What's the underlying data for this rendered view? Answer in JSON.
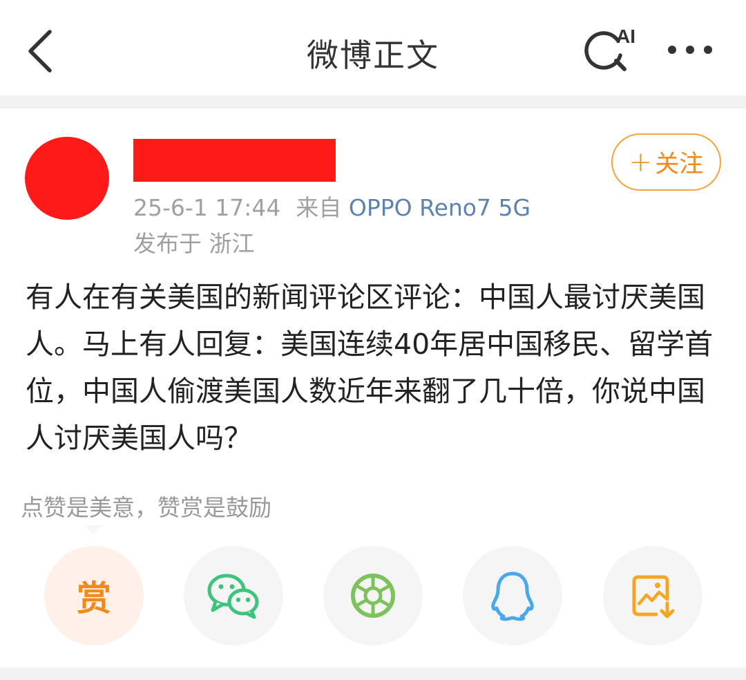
{
  "header": {
    "title": "微博正文",
    "ai_label": "AI",
    "back_icon": "chevron-left-icon",
    "search_icon": "ai-search-icon",
    "more_icon": "more-dots-icon"
  },
  "post": {
    "follow_label": "关注",
    "follow_plus": "+",
    "timestamp": "25-6-1 17:44",
    "source_prefix": "来自",
    "device": "OPPO Reno7 5G",
    "location": "发布于 浙江",
    "text": "有人在有关美国的新闻评论区评论：中国人最讨厌美国人。马上有人回复：美国连续40年居中国移民、留学首位，中国人偷渡美国人数近年来翻了几十倍，你说中国人讨厌美国人吗？"
  },
  "reward": {
    "hint": "点赞是美意，赞赏是鼓励",
    "button_char": "赏"
  },
  "share": {
    "items": [
      "reward-icon",
      "wechat-icon",
      "moments-icon",
      "qq-icon",
      "save-image-icon"
    ]
  },
  "colors": {
    "accent": "#f08a1c",
    "device_link": "#5b82b0",
    "redaction": "#ff1a1a",
    "wechat_green": "#3cc47c",
    "moments_green": "#7dc35b",
    "qq_blue": "#4aa8ea",
    "save_orange": "#f5a623"
  }
}
